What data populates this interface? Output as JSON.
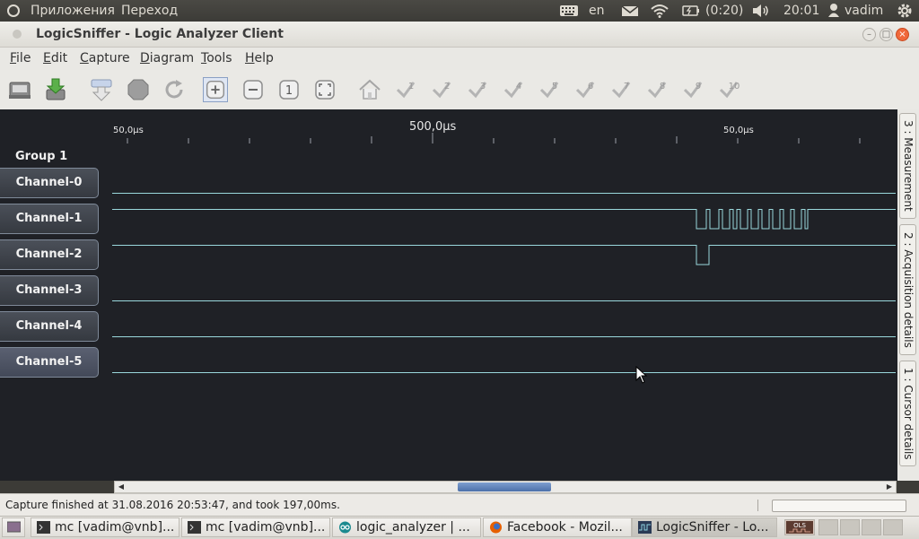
{
  "system_panel": {
    "apps_menu": "Приложения",
    "places_menu": "Переход",
    "keyboard_layout": "en",
    "battery_time": "(0:20)",
    "clock": "20:01",
    "user": "vadim"
  },
  "window": {
    "title": "LogicSniffer - Logic Analyzer Client"
  },
  "menu": {
    "file": {
      "prefix": "F",
      "rest": "ile"
    },
    "edit": {
      "prefix": "E",
      "rest": "dit"
    },
    "capture": {
      "prefix": "C",
      "rest": "apture"
    },
    "diagram": {
      "prefix": "D",
      "rest": "iagram"
    },
    "tools": {
      "prefix": "T",
      "rest": "ools"
    },
    "help": {
      "prefix": "H",
      "rest": "elp"
    }
  },
  "toolbar": {
    "buttons": [
      {
        "icon": "open-project-icon"
      },
      {
        "icon": "save-project-icon"
      },
      {
        "icon": "capture-icon"
      },
      {
        "icon": "stop-icon"
      },
      {
        "icon": "repeat-capture-icon"
      },
      {
        "icon": "zoom-in-icon",
        "active": true
      },
      {
        "icon": "zoom-out-icon"
      },
      {
        "icon": "zoom-original-icon",
        "label": "1"
      },
      {
        "icon": "zoom-fit-icon"
      },
      {
        "icon": "home-icon"
      }
    ],
    "markers": [
      "1",
      "2",
      "3",
      "4",
      "5",
      "6",
      "7",
      "8",
      "9",
      "10"
    ]
  },
  "ruler": {
    "left_label": "50,0μs",
    "major_label": "500,0μs",
    "right_label": "50,0μs"
  },
  "signal_colors": {
    "background": "#1f2126",
    "trace": "#9ad8dc"
  },
  "diagram": {
    "group_label": "Group 1",
    "channels": [
      {
        "label": "Channel-0"
      },
      {
        "label": "Channel-1"
      },
      {
        "label": "Channel-2"
      },
      {
        "label": "Channel-3"
      },
      {
        "label": "Channel-4"
      },
      {
        "label": "Channel-5",
        "selected": true
      }
    ]
  },
  "side_tabs": [
    "3 : Measurement",
    "2 : Acquisition details",
    "1 : Cursor details"
  ],
  "status": {
    "text": "Capture finished at 31.08.2016 20:53:47, and took 197,00ms."
  },
  "taskbar": {
    "tasks": [
      {
        "label": "mc [vadim@vnb]...",
        "icon": "terminal-icon"
      },
      {
        "label": "mc [vadim@vnb]...",
        "icon": "terminal-icon"
      },
      {
        "label": "logic_analyzer | ...",
        "icon": "arduino-icon"
      },
      {
        "label": "Facebook - Mozil...",
        "icon": "firefox-icon"
      },
      {
        "label": "LogicSniffer - Lo...",
        "icon": "ols-icon",
        "active": true
      }
    ],
    "tray_label": "OLS"
  }
}
